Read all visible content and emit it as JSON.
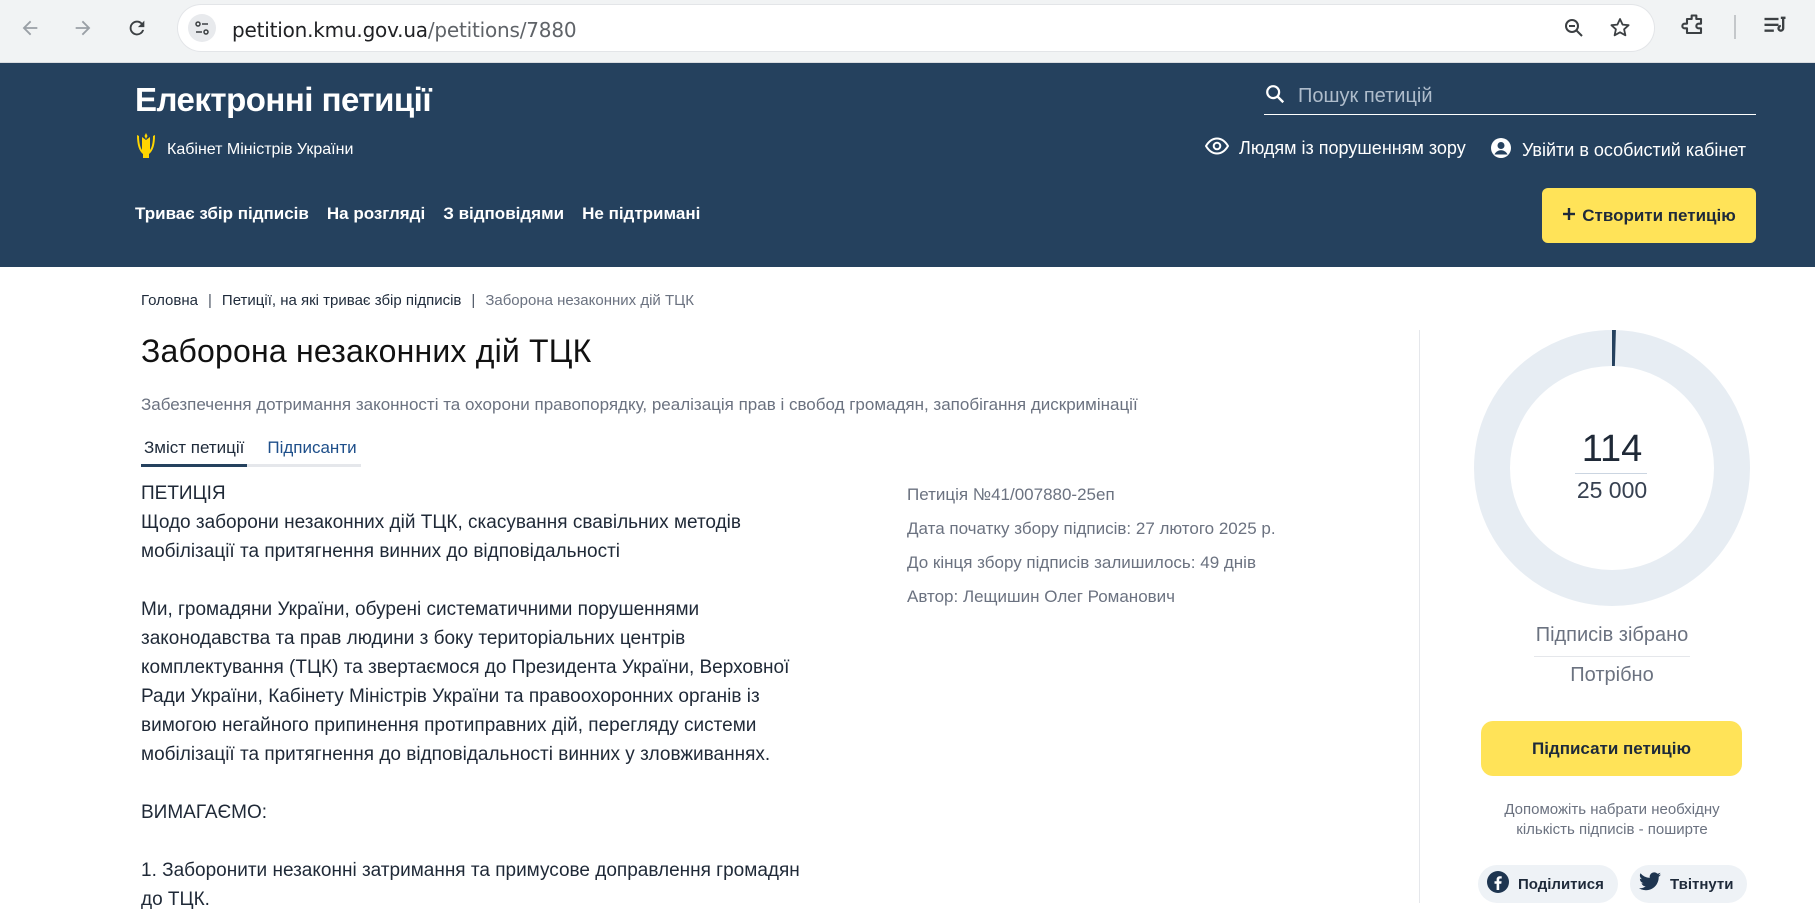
{
  "browser": {
    "url_domain": "petition.kmu.gov.ua",
    "url_path": "/petitions/7880"
  },
  "header": {
    "site_title": "Електронні петиції",
    "gov_name": "Кабінет Міністрів України",
    "search_placeholder": "Пошук петицій",
    "vision_link": "Людям із порушенням зору",
    "login_link": "Увійти в особистий кабінет",
    "menu": [
      {
        "label": "Триває збір підписів"
      },
      {
        "label": "На розгляді"
      },
      {
        "label": "З відповідями"
      },
      {
        "label": "Не підтримані"
      }
    ],
    "create_button": "Створити петицію"
  },
  "breadcrumb": {
    "home": "Головна",
    "section": "Петиції, на які триває збір підписів",
    "current": "Заборона незаконних дій ТЦК"
  },
  "petition": {
    "title": "Заборона незаконних дій ТЦК",
    "category": "Забезпечення дотримання законності та охорони правопорядку, реалізація прав і свобод громадян, запобігання дискримінації",
    "tabs": [
      "Зміст петиції",
      "Підписанти"
    ],
    "body": {
      "heading": "ПЕТИЦІЯ",
      "line2": "Щодо заборони незаконних дій ТЦК, скасування свавільних методів",
      "line3": "мобілізації та притягнення винних до відповідальності",
      "p1_l1": "Ми, громадяни України, обурені систематичними порушеннями",
      "p1_l2": "законодавства та прав людини з боку територіальних центрів",
      "p1_l3": "комплектування (ТЦК) та звертаємося до Президента України, Верховної",
      "p1_l4": "Ради України, Кабінету Міністрів України та правоохоронних органів із",
      "p1_l5": "вимогою негайного припинення протиправних дій, перегляду системи",
      "p1_l6": "мобілізації та притягнення до відповідальності винних у зловживаннях.",
      "demand": "ВИМАГАЄМО:",
      "item1_l1": "1. Заборонити незаконні затримання та примусове доправлення громадян",
      "item1_l2": "до ТЦК."
    },
    "meta": {
      "number": "Петиція №41/007880-25еп",
      "start_date": "Дата початку збору підписів: 27 лютого 2025 р.",
      "remaining": "До кінця збору підписів залишилось: 49 днів",
      "author": "Автор: Лещишин Олег Романович"
    }
  },
  "signatures": {
    "collected": "114",
    "required": "25 000",
    "collected_value": 114,
    "required_value": 25000,
    "progress_fraction": 0.00456,
    "label_collected": "Підписів зібрано",
    "label_needed": "Потрібно",
    "sign_button": "Підписати петицію",
    "help_text_l1": "Допоможіть набрати необхідну",
    "help_text_l2": "кількість підписів - поширте",
    "share_facebook": "Поділитися",
    "share_twitter": "Твітнути"
  },
  "colors": {
    "header_bg": "#25415e",
    "accent_yellow": "#ffe358",
    "ring_track": "#e7edf3",
    "ring_fill": "#25415e"
  }
}
